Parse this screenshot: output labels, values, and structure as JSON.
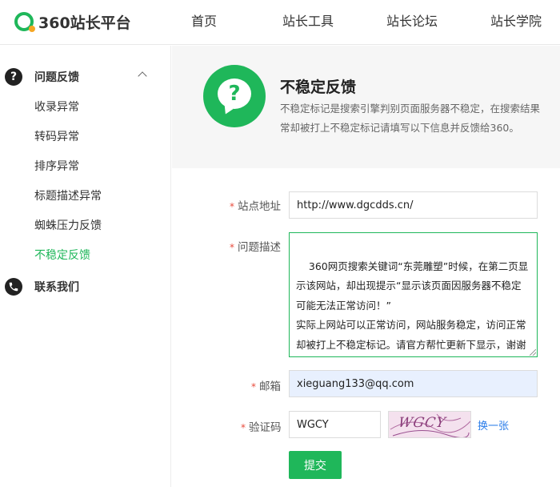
{
  "brand": {
    "name": "360站长平台",
    "accent": "#1fb75a"
  },
  "nav": [
    {
      "label": "首页"
    },
    {
      "label": "站长工具"
    },
    {
      "label": "站长论坛"
    },
    {
      "label": "站长学院"
    }
  ],
  "sidebar": {
    "group1": {
      "label": "问题反馈",
      "icon": "question-circle-icon",
      "expanded": true
    },
    "items": [
      {
        "label": "收录异常"
      },
      {
        "label": "转码异常"
      },
      {
        "label": "排序异常"
      },
      {
        "label": "标题描述异常"
      },
      {
        "label": "蜘蛛压力反馈"
      },
      {
        "label": "不稳定反馈",
        "active": true
      }
    ],
    "group2": {
      "label": "联系我们",
      "icon": "phone-icon"
    }
  },
  "hero": {
    "title": "不稳定反馈",
    "desc_line1": "不稳定标记是搜索引擎判别页面服务器不稳定，在搜索结果",
    "desc_line2": "常却被打上不稳定标记请填写以下信息并反馈给360。"
  },
  "form": {
    "site": {
      "label": "站点地址",
      "value": "http://www.dgcdds.cn/"
    },
    "problem": {
      "label": "问题描述",
      "value": "360网页搜索关键词“东莞雕塑”时候，在第二页显示该网站，却出现提示“显示该页面因服务器不稳定可能无法正常访问！”\n实际上网站可以正常访问，网站服务稳定，访问正常却被打上不稳定标记。请官方帮忙更新下显示，谢谢"
    },
    "email": {
      "label": "邮箱",
      "value": "xieguang133@qq.com"
    },
    "captcha": {
      "label": "验证码",
      "value": "WGCY",
      "image_text": "WGCY",
      "refresh_label": "换一张"
    },
    "submit_label": "提交"
  }
}
